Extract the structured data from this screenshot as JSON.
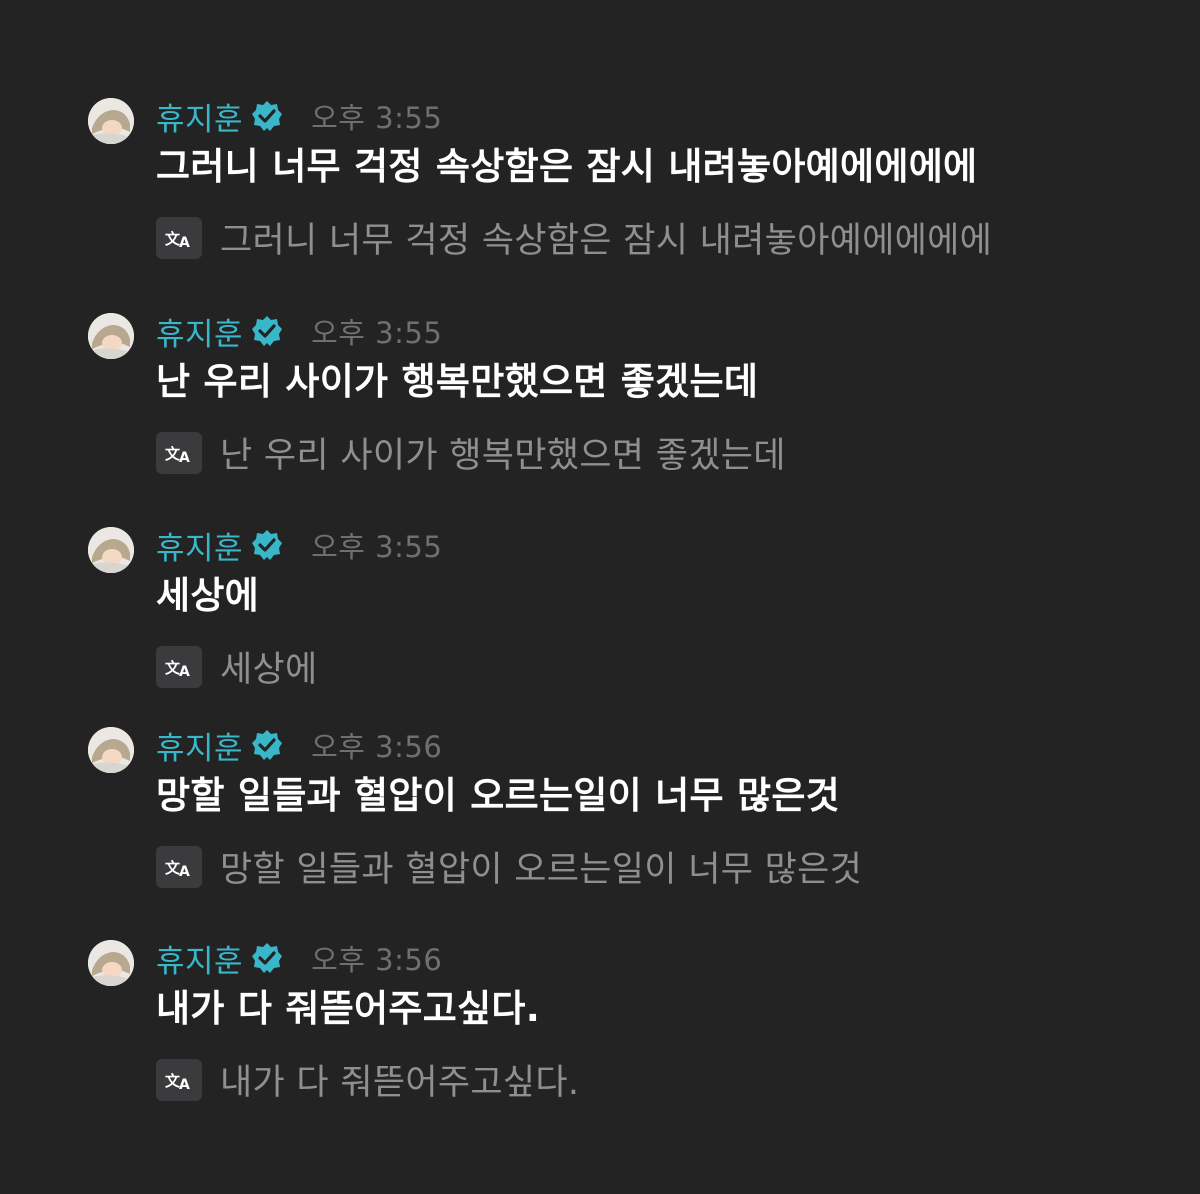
{
  "author": {
    "name": "휴지훈",
    "verified_color": "#39b7c9",
    "name_color": "#39b7c9"
  },
  "icons": {
    "avatar": "avatar-photo",
    "verified": "verified-badge-icon",
    "translate": "translate-icon"
  },
  "messages": [
    {
      "time": "오후 3:55",
      "text": "그러니 너무 걱정 속상함은 잠시 내려놓아예에에에에",
      "translation": "그러니 너무 걱정 속상함은 잠시 내려놓아예에에에에"
    },
    {
      "time": "오후 3:55",
      "text": "난 우리 사이가 행복만했으면 좋겠는데",
      "translation": "난 우리 사이가 행복만했으면 좋겠는데"
    },
    {
      "time": "오후 3:55",
      "text": "세상에",
      "translation": "세상에"
    },
    {
      "time": "오후 3:56",
      "text": "망할 일들과 혈압이 오르는일이 너무 많은것",
      "translation": "망할 일들과 혈압이 오르는일이 너무 많은것"
    },
    {
      "time": "오후 3:56",
      "text": "내가 다 줘뜯어주고싶다.",
      "translation": "내가 다 줘뜯어주고싶다."
    }
  ]
}
